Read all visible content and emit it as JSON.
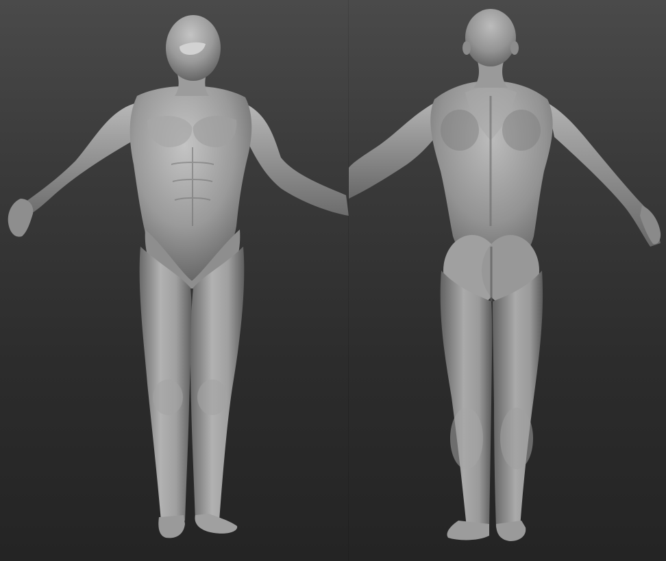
{
  "scene": {
    "background_top": "#4a4a4a",
    "background_bottom": "#242424",
    "material_light": "#b4b4b4",
    "material_mid": "#8c8c8c",
    "material_dark": "#5e5e5e"
  },
  "views": {
    "front": {
      "icon": "male-anatomy-front-view"
    },
    "back": {
      "icon": "male-anatomy-back-view"
    }
  }
}
